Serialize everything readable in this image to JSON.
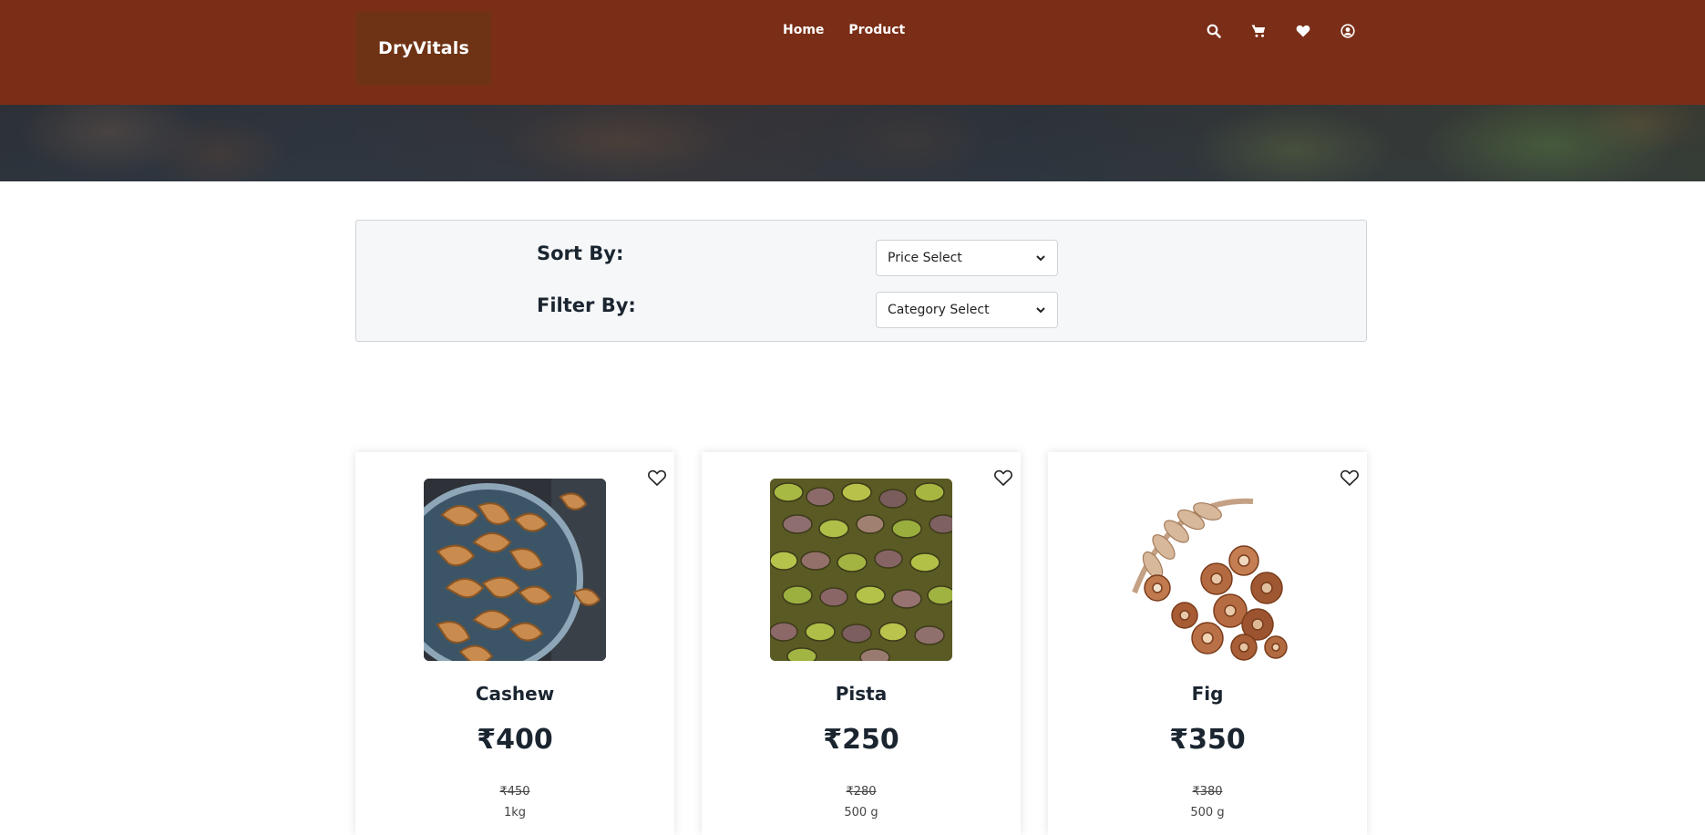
{
  "header": {
    "logo": "DryVitals",
    "nav": [
      {
        "label": "Home"
      },
      {
        "label": "Product"
      }
    ],
    "icons": [
      "search-icon",
      "cart-icon",
      "heart-icon",
      "user-icon"
    ]
  },
  "filters": {
    "sort_label": "Sort By:",
    "sort_selected": "Price Select",
    "filter_label": "Filter By:",
    "filter_selected": "Category Select"
  },
  "products": [
    {
      "name": "Cashew",
      "price": "₹400",
      "old_price": "₹450",
      "weight": "1kg",
      "image": "cashew"
    },
    {
      "name": "Pista",
      "price": "₹250",
      "old_price": "₹280",
      "weight": "500 g",
      "image": "pistachio"
    },
    {
      "name": "Fig",
      "price": "₹350",
      "old_price": "₹380",
      "weight": "500 g",
      "image": "dried-fig"
    }
  ],
  "colors": {
    "header_bg": "#7a2e17",
    "logo_bg": "#6e3315",
    "text_dark": "#1a2530"
  }
}
